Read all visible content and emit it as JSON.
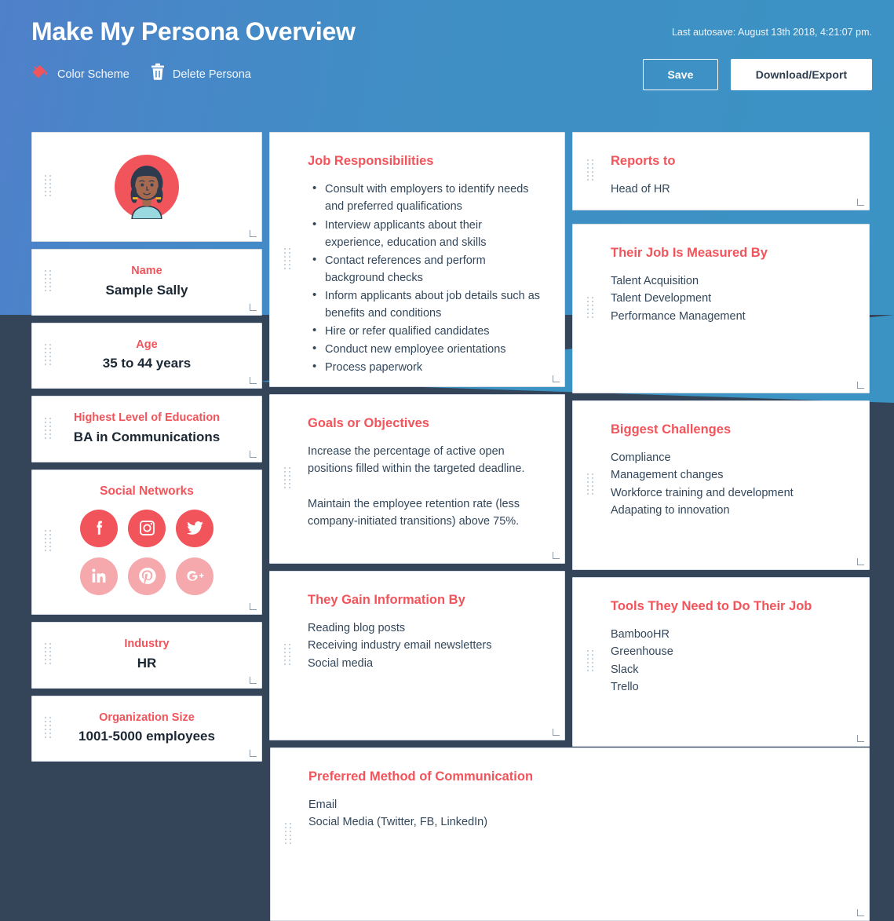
{
  "header": {
    "title": "Make My Persona Overview",
    "autosave": "Last autosave: August 13th 2018, 4:21:07 pm.",
    "actions": [
      {
        "label": "Color Scheme",
        "icon": "paint-bucket-icon"
      },
      {
        "label": "Delete Persona",
        "icon": "trash-icon"
      }
    ],
    "buttons": {
      "save": "Save",
      "download": "Download/Export"
    }
  },
  "colors": {
    "accent": "#f2545b",
    "accent_muted": "#f6a9ad",
    "header_blue": "#3f8fc4",
    "header_blue_left": "#4f80c9",
    "background_navy": "#344559",
    "text": "#33475b",
    "value_text": "#1b2733"
  },
  "sidebar": {
    "avatar": {
      "name": "persona-avatar",
      "circle_color": "#f2545b",
      "skin_color": "#a4694f",
      "hair_color": "#2e3b4e",
      "shirt_color": "#9ad9e0"
    },
    "fields": [
      {
        "label": "Name",
        "value": "Sample Sally"
      },
      {
        "label": "Age",
        "value": "35 to 44 years"
      },
      {
        "label": "Highest Level of Education",
        "value": "BA in Communications"
      }
    ],
    "social": {
      "title": "Social Networks",
      "networks": [
        {
          "name": "facebook",
          "active": true
        },
        {
          "name": "instagram",
          "active": true
        },
        {
          "name": "twitter",
          "active": true
        },
        {
          "name": "linkedin",
          "active": false
        },
        {
          "name": "pinterest",
          "active": false
        },
        {
          "name": "googleplus",
          "active": false
        }
      ]
    },
    "fields2": [
      {
        "label": "Industry",
        "value": "HR"
      },
      {
        "label": "Organization Size",
        "value": "1001-5000 employees"
      }
    ]
  },
  "cards": {
    "job_responsibilities": {
      "title": "Job Responsibilities",
      "items": [
        "Consult with employers to identify needs and preferred qualifications",
        "Interview applicants about their experience, education and skills",
        "Contact references and perform background checks",
        "Inform applicants about job details such as benefits and conditions",
        "Hire or refer qualified candidates",
        "Conduct new employee orientations",
        "Process paperwork"
      ]
    },
    "reports_to": {
      "title": "Reports to",
      "items": [
        "Head of HR"
      ]
    },
    "measured_by": {
      "title": "Their Job Is Measured By",
      "items": [
        "Talent Acquisition",
        "Talent Development",
        "Performance Management"
      ]
    },
    "goals": {
      "title": "Goals or Objectives",
      "paragraph1": "Increase the percentage of active open positions filled within the targeted deadline.",
      "paragraph2": "Maintain the employee retention rate (less company-initiated transitions) above 75%."
    },
    "challenges": {
      "title": "Biggest Challenges",
      "items": [
        "Compliance",
        "Management changes",
        "Workforce training and development",
        "Adapating to innovation"
      ]
    },
    "information": {
      "title": "They Gain Information By",
      "items": [
        "Reading blog posts",
        "Receiving industry email newsletters",
        "Social media"
      ]
    },
    "tools": {
      "title": "Tools They Need to Do Their Job",
      "items": [
        "BambooHR",
        "Greenhouse",
        "Slack",
        "Trello"
      ]
    },
    "communication": {
      "title": "Preferred Method of Communication",
      "items": [
        "Email",
        "Social Media (Twitter, FB, LinkedIn)"
      ]
    }
  }
}
